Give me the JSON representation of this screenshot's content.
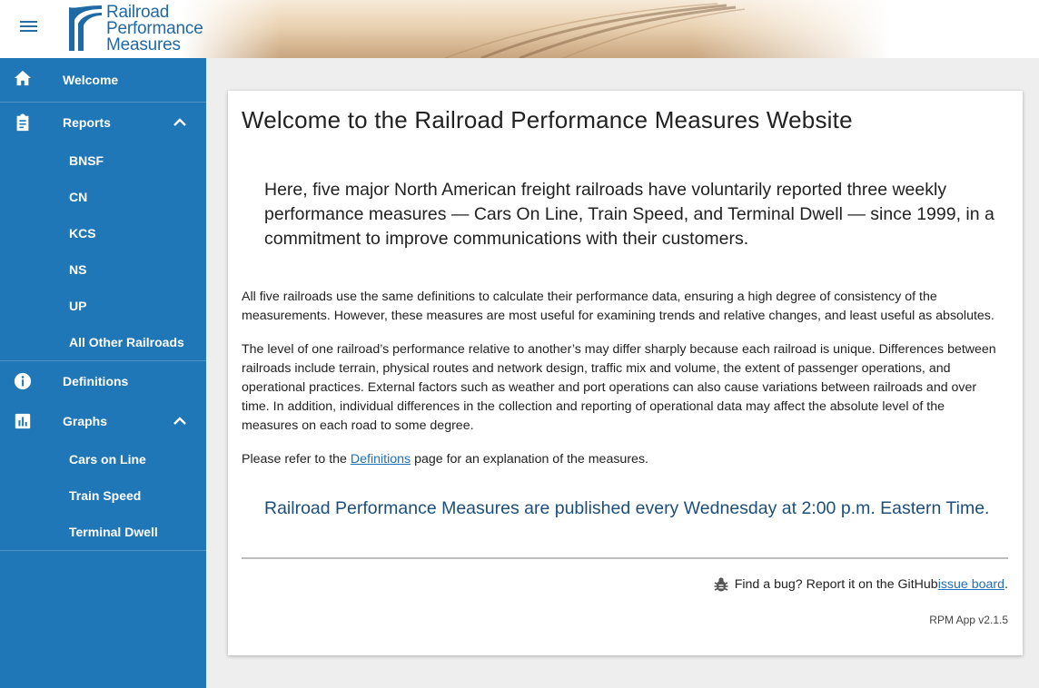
{
  "header": {
    "logo_lines": [
      "Railroad",
      "Performance",
      "Measures"
    ]
  },
  "sidebar": {
    "welcome": "Welcome",
    "reports": {
      "label": "Reports",
      "items": [
        "BNSF",
        "CN",
        "KCS",
        "NS",
        "UP",
        "All Other Railroads"
      ]
    },
    "definitions": "Definitions",
    "graphs": {
      "label": "Graphs",
      "items": [
        "Cars on Line",
        "Train Speed",
        "Terminal Dwell"
      ]
    }
  },
  "main": {
    "title": "Welcome to the Railroad Performance Measures Website",
    "lead": "Here, five major North American freight railroads have voluntarily reported three weekly performance measures — Cars On Line, Train Speed, and Terminal Dwell — since 1999, in a commitment to improve communications with their customers.",
    "para1": "All five railroads use the same definitions to calculate their performance data, ensuring a high degree of consistency of the measurements. However, these measures are most useful for examining trends and relative changes, and least useful as absolutes.",
    "para2": "The level of one railroad’s performance relative to another’s may differ sharply because each railroad is unique. Differences between railroads include terrain, physical routes and network design, traffic mix and volume, the extent of passenger operations, and operational practices. External factors such as weather and port operations can also cause variations between railroads and over time. In addition, individual differences in the collection and reporting of operational data may affect the absolute level of the measures on each road to some degree.",
    "para3_before": "Please refer to the ",
    "para3_link": "Definitions",
    "para3_after": " page for an explanation of the measures.",
    "published": "Railroad Performance Measures are published every Wednesday at 2:00 p.m. Eastern Time.",
    "bug_text": "Find a bug? Report it on the GitHub ",
    "bug_link": "issue board",
    "bug_end": ".",
    "version": "RPM App v2.1.5"
  },
  "colors": {
    "sidebar_bg": "#1f77b8",
    "brand_blue": "#1f6aa5",
    "link": "#1f6fb5",
    "published_text": "#1c4f7c"
  },
  "icons": {
    "menu": "hamburger-icon",
    "welcome": "home-icon",
    "reports": "clipboard-icon",
    "definitions": "info-icon",
    "graphs": "bar-chart-icon",
    "expand": "chevron-up-icon",
    "bug": "bug-icon"
  }
}
